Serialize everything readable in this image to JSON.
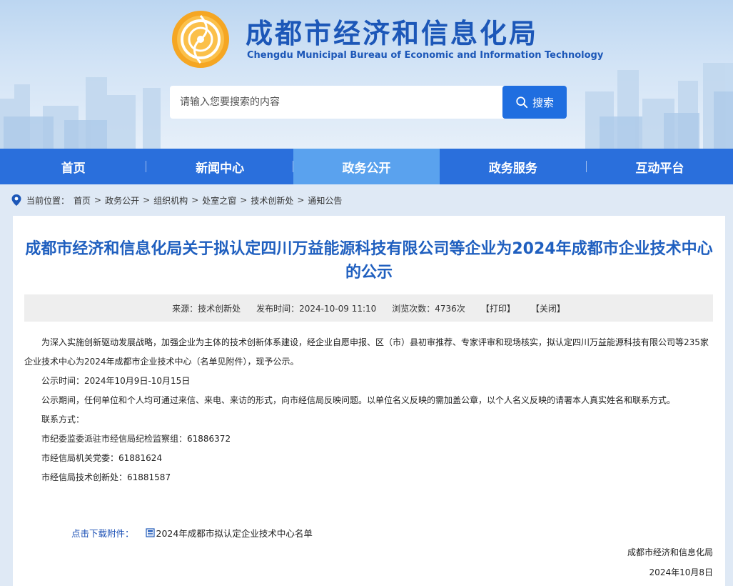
{
  "header": {
    "title": "成都市经济和信息化局",
    "subtitle": "Chengdu Municipal Bureau of Economic and Information Technology",
    "search_placeholder": "请输入您要搜索的内容",
    "search_button": "搜索"
  },
  "nav": {
    "items": [
      "首页",
      "新闻中心",
      "政务公开",
      "政务服务",
      "互动平台"
    ],
    "active": "政务公开"
  },
  "breadcrumb": {
    "label": "当前位置：",
    "items": [
      "首页",
      "政务公开",
      "组织机构",
      "处室之窗",
      "技术创新处",
      "通知公告"
    ],
    "separator": ">"
  },
  "article": {
    "title": "成都市经济和信息化局关于拟认定四川万益能源科技有限公司等企业为2024年成都市企业技术中心的公示",
    "meta": {
      "source": "来源：技术创新处",
      "publish_time": "发布时间：2024-10-09 11:10",
      "views": "浏览次数：4736次",
      "print": "【打印】",
      "close": "【关闭】"
    },
    "paragraphs": [
      "为深入实施创新驱动发展战略，加强企业为主体的技术创新体系建设，经企业自愿申报、区（市）县初审推荐、专家评审和现场核实，拟认定四川万益能源科技有限公司等235家企业技术中心为2024年成都市企业技术中心（名单见附件），现予公示。",
      "公示时间：2024年10月9日-10月15日",
      "公示期间，任何单位和个人均可通过来信、来电、来访的形式，向市经信局反映问题。以单位名义反映的需加盖公章，以个人名义反映的请署本人真实姓名和联系方式。",
      "联系方式：",
      "市纪委监委派驻市经信局纪检监察组：61886372",
      "市经信局机关党委：61881624",
      "市经信局技术创新处：61881587"
    ],
    "attachment_label": "点击下载附件：",
    "attachment_name": "2024年成都市拟认定企业技术中心名单",
    "sign_org": "成都市经济和信息化局",
    "sign_date": "2024年10月8日"
  },
  "colors": {
    "brand": "#1c57b8",
    "nav": "#2a6fdc",
    "nav_active": "#5aa2ee",
    "title": "#1f5fbf"
  }
}
